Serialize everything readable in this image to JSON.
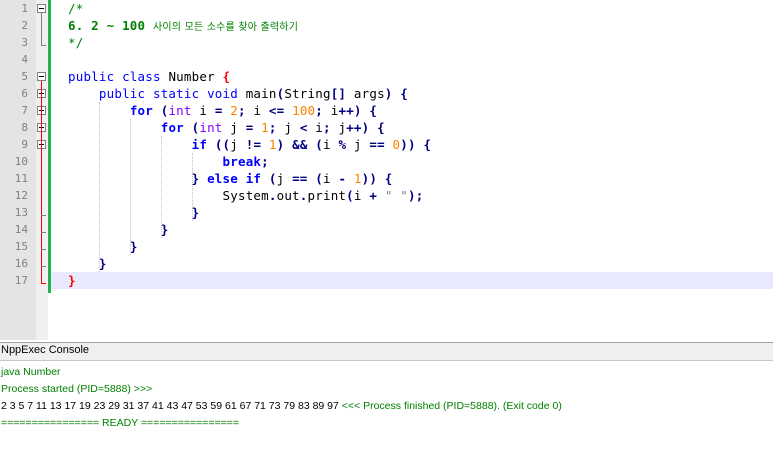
{
  "editor": {
    "lines": [
      {
        "n": "1",
        "tokens": [
          {
            "c": "cm",
            "t": "/*"
          }
        ]
      },
      {
        "n": "2",
        "tokens": [
          {
            "c": "cmb",
            "t": "6. 2 ~ 100 "
          },
          {
            "c": "ko",
            "t": "사이의 모든 소수를 찾아 출력하기"
          }
        ]
      },
      {
        "n": "3",
        "tokens": [
          {
            "c": "cm",
            "t": "*/"
          }
        ]
      },
      {
        "n": "4",
        "tokens": []
      },
      {
        "n": "5",
        "tokens": [
          {
            "c": "kw-plain",
            "t": "public class "
          },
          {
            "c": "pl",
            "t": "Number "
          },
          {
            "c": "br-red",
            "t": "{"
          }
        ]
      },
      {
        "n": "6",
        "tokens": [
          {
            "c": "pl",
            "t": "    "
          },
          {
            "c": "kw-plain",
            "t": "public static void "
          },
          {
            "c": "pl",
            "t": "main"
          },
          {
            "c": "op",
            "t": "("
          },
          {
            "c": "pl",
            "t": "String"
          },
          {
            "c": "op",
            "t": "[] "
          },
          {
            "c": "pl",
            "t": "args"
          },
          {
            "c": "op",
            "t": ") {"
          }
        ]
      },
      {
        "n": "7",
        "tokens": [
          {
            "c": "pl",
            "t": "        "
          },
          {
            "c": "kw",
            "t": "for "
          },
          {
            "c": "op",
            "t": "("
          },
          {
            "c": "kt",
            "t": "int "
          },
          {
            "c": "pl",
            "t": "i "
          },
          {
            "c": "op",
            "t": "= "
          },
          {
            "c": "nm",
            "t": "2"
          },
          {
            "c": "op",
            "t": "; "
          },
          {
            "c": "pl",
            "t": "i "
          },
          {
            "c": "op",
            "t": "<= "
          },
          {
            "c": "nm",
            "t": "100"
          },
          {
            "c": "op",
            "t": "; "
          },
          {
            "c": "pl",
            "t": "i"
          },
          {
            "c": "op",
            "t": "++) {"
          }
        ]
      },
      {
        "n": "8",
        "tokens": [
          {
            "c": "pl",
            "t": "            "
          },
          {
            "c": "kw",
            "t": "for "
          },
          {
            "c": "op",
            "t": "("
          },
          {
            "c": "kt",
            "t": "int "
          },
          {
            "c": "pl",
            "t": "j "
          },
          {
            "c": "op",
            "t": "= "
          },
          {
            "c": "nm",
            "t": "1"
          },
          {
            "c": "op",
            "t": "; "
          },
          {
            "c": "pl",
            "t": "j "
          },
          {
            "c": "op",
            "t": "< "
          },
          {
            "c": "pl",
            "t": "i"
          },
          {
            "c": "op",
            "t": "; "
          },
          {
            "c": "pl",
            "t": "j"
          },
          {
            "c": "op",
            "t": "++) {"
          }
        ]
      },
      {
        "n": "9",
        "tokens": [
          {
            "c": "pl",
            "t": "                "
          },
          {
            "c": "kw",
            "t": "if "
          },
          {
            "c": "op",
            "t": "(("
          },
          {
            "c": "pl",
            "t": "j "
          },
          {
            "c": "op",
            "t": "!= "
          },
          {
            "c": "nm",
            "t": "1"
          },
          {
            "c": "op",
            "t": ") && ("
          },
          {
            "c": "pl",
            "t": "i "
          },
          {
            "c": "op",
            "t": "% "
          },
          {
            "c": "pl",
            "t": "j "
          },
          {
            "c": "op",
            "t": "== "
          },
          {
            "c": "nm",
            "t": "0"
          },
          {
            "c": "op",
            "t": ")) {"
          }
        ]
      },
      {
        "n": "10",
        "tokens": [
          {
            "c": "pl",
            "t": "                    "
          },
          {
            "c": "kw",
            "t": "break"
          },
          {
            "c": "op",
            "t": ";"
          }
        ]
      },
      {
        "n": "11",
        "tokens": [
          {
            "c": "pl",
            "t": "                "
          },
          {
            "c": "op",
            "t": "} "
          },
          {
            "c": "kw",
            "t": "else if "
          },
          {
            "c": "op",
            "t": "("
          },
          {
            "c": "pl",
            "t": "j "
          },
          {
            "c": "op",
            "t": "== ("
          },
          {
            "c": "pl",
            "t": "i "
          },
          {
            "c": "op",
            "t": "- "
          },
          {
            "c": "nm",
            "t": "1"
          },
          {
            "c": "op",
            "t": ")) {"
          }
        ]
      },
      {
        "n": "12",
        "tokens": [
          {
            "c": "pl",
            "t": "                    System"
          },
          {
            "c": "op",
            "t": "."
          },
          {
            "c": "pl",
            "t": "out"
          },
          {
            "c": "op",
            "t": "."
          },
          {
            "c": "pl",
            "t": "print"
          },
          {
            "c": "op",
            "t": "("
          },
          {
            "c": "pl",
            "t": "i "
          },
          {
            "c": "op",
            "t": "+ "
          },
          {
            "c": "st",
            "t": "\" \""
          },
          {
            "c": "op",
            "t": ");"
          }
        ]
      },
      {
        "n": "13",
        "tokens": [
          {
            "c": "pl",
            "t": "                "
          },
          {
            "c": "op",
            "t": "}"
          }
        ]
      },
      {
        "n": "14",
        "tokens": [
          {
            "c": "pl",
            "t": "            "
          },
          {
            "c": "op",
            "t": "}"
          }
        ]
      },
      {
        "n": "15",
        "tokens": [
          {
            "c": "pl",
            "t": "        "
          },
          {
            "c": "op",
            "t": "}"
          }
        ]
      },
      {
        "n": "16",
        "tokens": [
          {
            "c": "pl",
            "t": "    "
          },
          {
            "c": "op",
            "t": "}"
          }
        ]
      },
      {
        "n": "17",
        "tokens": [
          {
            "c": "br-red",
            "t": "}"
          }
        ]
      }
    ],
    "current_line": 17,
    "colors": {
      "keyword": "#0000ff",
      "type": "#8000ff",
      "number": "#ff8000",
      "operator": "#000080",
      "comment": "#008000",
      "string": "#808080",
      "brace_match": "#ff0000",
      "current_line_bg": "#e8e8ff",
      "change_bar": "#22b14c"
    }
  },
  "console": {
    "title": "NppExec Console",
    "lines": [
      {
        "color": "green",
        "text": "java Number"
      },
      {
        "color": "green",
        "text": "Process started (PID=5888) >>>"
      },
      {
        "color": "mixed",
        "parts": [
          {
            "color": "black",
            "text": "2 3 5 7 11 13 17 19 23 29 31 37 41 43 47 53 59 61 67 71 73 79 83 89 97 "
          },
          {
            "color": "green",
            "text": "<<< Process finished (PID=5888). (Exit code 0)"
          }
        ]
      },
      {
        "color": "green",
        "text": "================ READY ================"
      }
    ]
  }
}
